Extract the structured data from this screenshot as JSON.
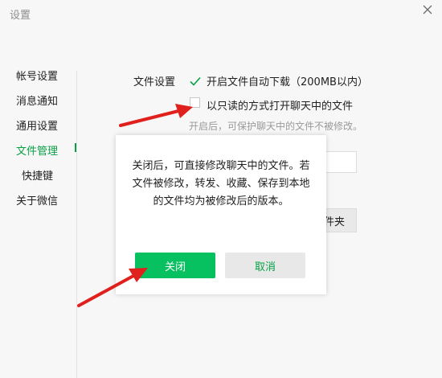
{
  "window": {
    "title": "设置"
  },
  "sidebar": {
    "items": [
      {
        "label": "帐号设置"
      },
      {
        "label": "消息通知"
      },
      {
        "label": "通用设置"
      },
      {
        "label": "文件管理"
      },
      {
        "label": "快捷键"
      },
      {
        "label": "关于微信"
      }
    ],
    "active_index": 3
  },
  "file_settings": {
    "section_label": "文件设置",
    "auto_download": {
      "label": "开启文件自动下载（200MB以内）",
      "checked": true
    },
    "read_only": {
      "label": "以只读的方式打开聊天中的文件",
      "checked": false
    },
    "hint": "开启后，可保护聊天中的文件不被修改。",
    "folder_button_partial": "件夹"
  },
  "dialog": {
    "message": "关闭后，可直接修改聊天中的文件。若文件被修改，转发、收藏、保存到本地的文件均为被修改后的版本。",
    "confirm_label": "关闭",
    "cancel_label": "取消"
  },
  "colors": {
    "accent": "#07c160",
    "accent_text": "#07a045",
    "annotation": "#e0201c"
  },
  "icons": {
    "close": "close-icon",
    "check": "checkmark-icon",
    "annotation_arrow": "red-arrow"
  }
}
